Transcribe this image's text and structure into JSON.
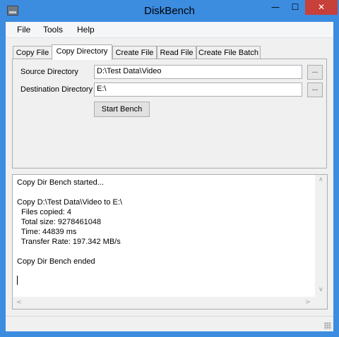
{
  "window": {
    "title": "DiskBench",
    "minimize_glyph": "—",
    "maximize_glyph": "☐",
    "close_glyph": "✕"
  },
  "menu": {
    "file": "File",
    "tools": "Tools",
    "help": "Help"
  },
  "tabs": [
    {
      "label": "Copy File",
      "active": false
    },
    {
      "label": "Copy Directory",
      "active": true
    },
    {
      "label": "Create File",
      "active": false
    },
    {
      "label": "Read File",
      "active": false
    },
    {
      "label": "Create File Batch",
      "active": false
    }
  ],
  "copy_directory": {
    "source_label": "Source Directory",
    "source_value": "D:\\Test Data\\Video",
    "destination_label": "Destination Directory",
    "destination_value": "E:\\",
    "browse_label": "...",
    "start_label": "Start Bench"
  },
  "log": {
    "lines": [
      "Copy Dir Bench started...",
      "",
      "Copy D:\\Test Data\\Video to E:\\",
      "  Files copied: 4",
      "  Total size: 9278461048",
      "  Time: 44839 ms",
      "  Transfer Rate: 197.342 MB/s",
      "",
      "Copy Dir Bench ended"
    ]
  },
  "scroll_glyphs": {
    "up": "∧",
    "down": "∨",
    "left": "<",
    "right": ">"
  },
  "colors": {
    "title_bar": "#3c8ce0",
    "close_button": "#c7403a",
    "client_background": "#f0f0f0"
  }
}
